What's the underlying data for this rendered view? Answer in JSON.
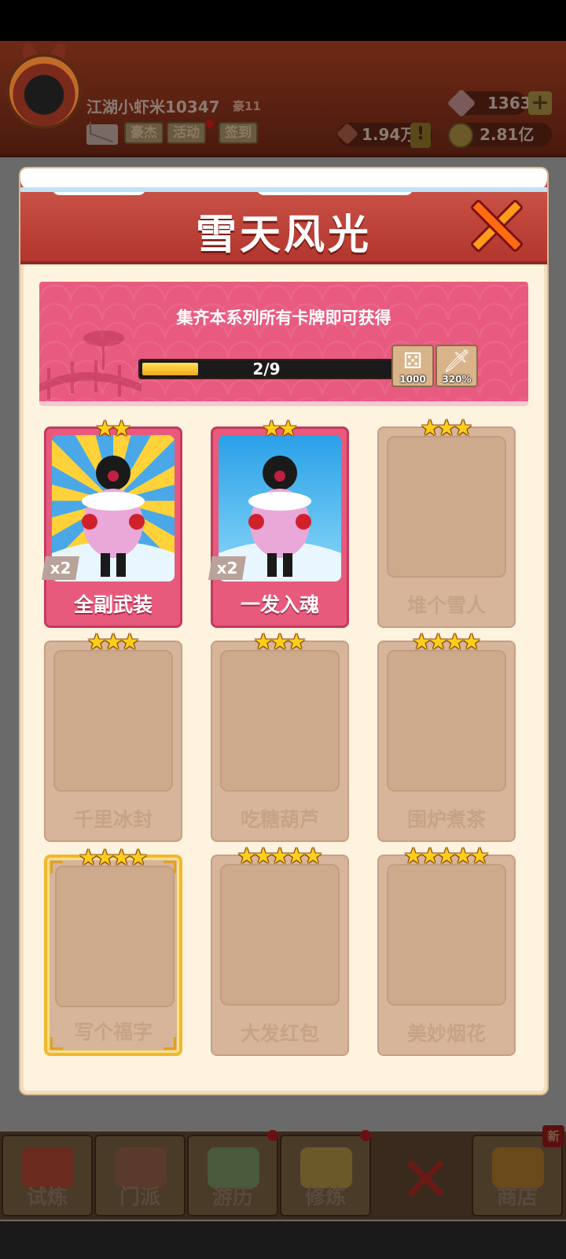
{
  "header": {
    "player_name": "江湖小虾米10347",
    "vip_level": "豪11",
    "tags": [
      "豪杰",
      "活动",
      "签到"
    ],
    "gems": "1363",
    "power": "1.94万",
    "coins": "2.81亿"
  },
  "modal": {
    "title": "雪天风光",
    "banner_text": "集齐本系列所有卡牌即可获得",
    "progress_text": "2/9",
    "progress_fraction": 0.222,
    "rewards": [
      {
        "icon": "dice-icon",
        "label": "1000"
      },
      {
        "icon": "sword-icon",
        "label": "320%"
      }
    ],
    "cards": [
      {
        "name": "全副武装",
        "stars": 2,
        "owned": true,
        "count": "x2"
      },
      {
        "name": "一发入魂",
        "stars": 2,
        "owned": true,
        "count": "x2"
      },
      {
        "name": "堆个雪人",
        "stars": 3,
        "owned": false
      },
      {
        "name": "千里冰封",
        "stars": 3,
        "owned": false
      },
      {
        "name": "吃糖葫芦",
        "stars": 3,
        "owned": false
      },
      {
        "name": "围炉煮茶",
        "stars": 4,
        "owned": false
      },
      {
        "name": "写个福字",
        "stars": 4,
        "owned": false,
        "gold_frame": true
      },
      {
        "name": "大发红包",
        "stars": 5,
        "owned": false
      },
      {
        "name": "美妙烟花",
        "stars": 5,
        "owned": false
      }
    ]
  },
  "nav": {
    "items": [
      "试炼",
      "门派",
      "游历",
      "修炼",
      "",
      "商店"
    ],
    "new_badge": "新"
  }
}
